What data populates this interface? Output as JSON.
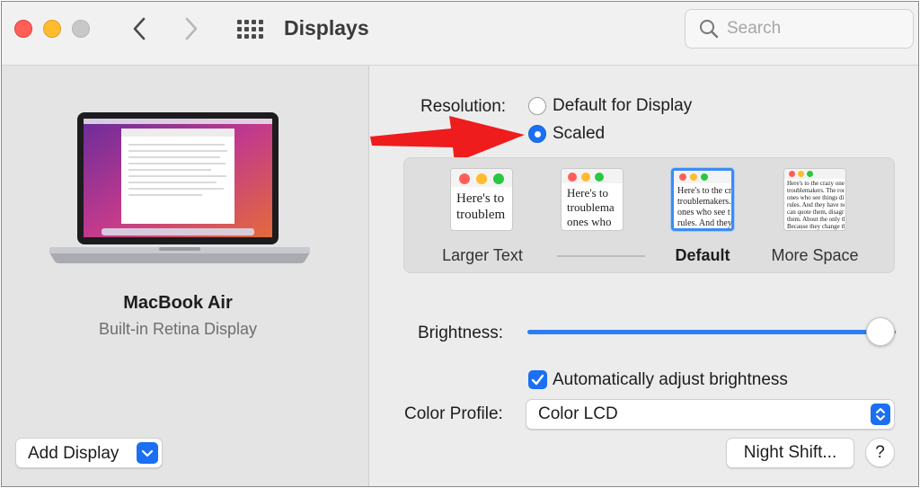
{
  "window": {
    "title": "Displays"
  },
  "toolbar": {
    "back_icon": "chevron-left-icon",
    "forward_icon": "chevron-right-icon",
    "grid_icon": "grid-icon"
  },
  "search": {
    "placeholder": "Search",
    "value": ""
  },
  "sidebar": {
    "display_name": "MacBook Air",
    "display_subtitle": "Built-in Retina Display",
    "add_display_label": "Add Display"
  },
  "resolution": {
    "label": "Resolution:",
    "options": [
      {
        "label": "Default for Display",
        "selected": false
      },
      {
        "label": "Scaled",
        "selected": true
      }
    ]
  },
  "scaling": {
    "options": [
      {
        "caption": "Larger Text",
        "preview_lines": [
          "Here's to",
          "troublem"
        ],
        "selected": false
      },
      {
        "caption": "",
        "preview_lines": [
          "Here's to",
          "troublema",
          "ones who"
        ],
        "selected": false
      },
      {
        "caption": "Default",
        "preview_lines": [
          "Here's to the cr",
          "troublemakers.",
          "ones who see t",
          "rules. And they"
        ],
        "selected": true
      },
      {
        "caption": "More Space",
        "preview_lines": [
          "Here's to the crazy one",
          "troublemakers. The rou",
          "ones who see things dif",
          "rules. And they have no",
          "can quote them, disagr",
          "them. About the only th",
          "Because they change th"
        ],
        "selected": false
      }
    ]
  },
  "brightness": {
    "label": "Brightness:",
    "level": 1.0
  },
  "auto_brightness": {
    "label": "Automatically adjust brightness",
    "checked": true
  },
  "color_profile": {
    "label": "Color Profile:",
    "value": "Color LCD"
  },
  "buttons": {
    "night_shift": "Night Shift...",
    "help": "?"
  },
  "annotation": {
    "arrow_color": "#ee1c1c"
  },
  "colors": {
    "accent": "#1a6ff3",
    "traffic_close": "#ff5f57",
    "traffic_min": "#febc2e"
  }
}
